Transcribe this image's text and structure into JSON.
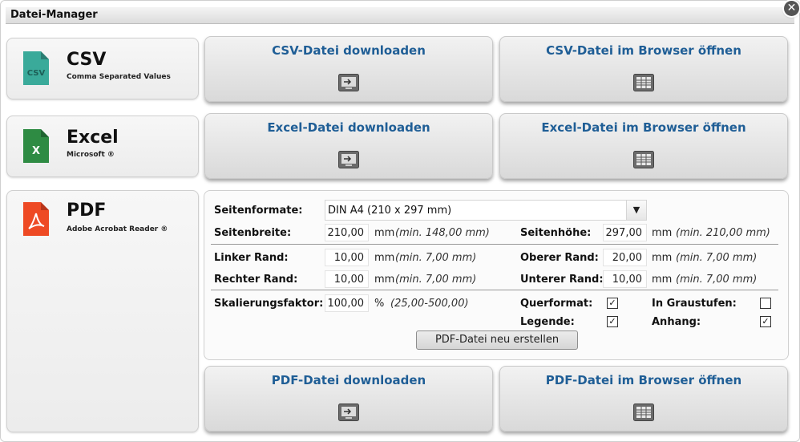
{
  "window": {
    "title": "Datei-Manager",
    "close_symbol": "✕"
  },
  "csv": {
    "title": "CSV",
    "subtitle": "Comma Separated Values",
    "icon_text": "CSV",
    "icon_color": "#3aaa9a",
    "download_label": "CSV-Datei downloaden",
    "open_label": "CSV-Datei im Browser öffnen"
  },
  "excel": {
    "title": "Excel",
    "subtitle": "Microsoft ®",
    "icon_text": "X",
    "icon_color": "#2e8b43",
    "download_label": "Excel-Datei downloaden",
    "open_label": "Excel-Datei im Browser öffnen"
  },
  "pdf": {
    "title": "PDF",
    "subtitle": "Adobe Acrobat Reader ®",
    "icon_color": "#ee4a24",
    "download_label": "PDF-Datei downloaden",
    "open_label": "PDF-Datei im Browser öffnen",
    "settings": {
      "format_label": "Seitenformate:",
      "format_value": "DIN A4 (210 x 297 mm)",
      "width_label": "Seitenbreite:",
      "width_value": "210,00",
      "width_unit": "mm",
      "width_hint": "(min. 148,00 mm)",
      "height_label": "Seitenhöhe:",
      "height_value": "297,00",
      "height_unit": "mm",
      "height_hint": "(min. 210,00 mm)",
      "left_label": "Linker Rand:",
      "left_value": "10,00",
      "left_unit": "mm",
      "left_hint": "(min. 7,00 mm)",
      "top_label": "Oberer Rand:",
      "top_value": "20,00",
      "top_unit": "mm",
      "top_hint": "(min. 7,00 mm)",
      "right_label": "Rechter Rand:",
      "right_value": "10,00",
      "right_unit": "mm",
      "right_hint": "(min. 7,00 mm)",
      "bottom_label": "Unterer Rand:",
      "bottom_value": "10,00",
      "bottom_unit": "mm",
      "bottom_hint": "(min. 7,00 mm)",
      "scale_label": "Skalierungsfaktor:",
      "scale_value": "100,00",
      "scale_unit": "%",
      "scale_hint": "(25,00-500,00)",
      "landscape_label": "Querformat:",
      "landscape_checked": true,
      "grayscale_label": "In Graustufen:",
      "grayscale_checked": false,
      "legend_label": "Legende:",
      "legend_checked": true,
      "attachment_label": "Anhang:",
      "attachment_checked": true,
      "rebuild_label": "PDF-Datei neu erstellen"
    }
  },
  "icons": {
    "download": "download-to-screen-icon",
    "browser": "browser-table-icon"
  },
  "colors": {
    "button_label": "#1f5e96"
  }
}
